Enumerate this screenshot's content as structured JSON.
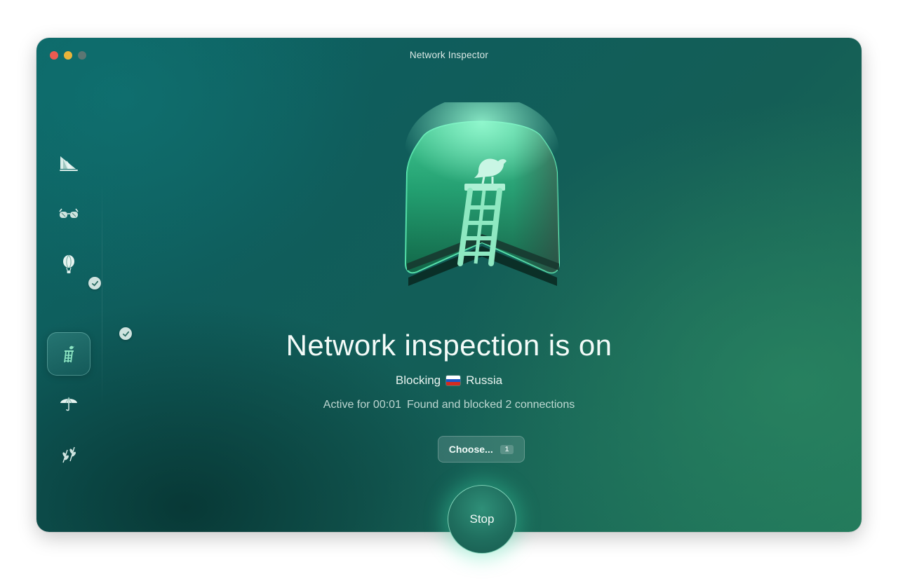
{
  "window": {
    "title": "Network Inspector",
    "traffic_lights": [
      "close",
      "minimize",
      "maximize"
    ]
  },
  "sidebar": {
    "items": [
      {
        "name": "ship-icon",
        "active": false,
        "checked": false
      },
      {
        "name": "glasses-icon",
        "active": false,
        "checked": false
      },
      {
        "name": "balloon-icon",
        "active": false,
        "checked": true
      },
      {
        "name": "lookout-ladder-icon",
        "active": true,
        "checked": true
      },
      {
        "name": "umbrella-icon",
        "active": false,
        "checked": false
      },
      {
        "name": "leaves-icon",
        "active": false,
        "checked": false
      }
    ]
  },
  "main": {
    "hero_icon": "lookout-bird-ladder-icon",
    "headline": "Network inspection is on",
    "status_prefix": "Blocking",
    "country": "Russia",
    "flag_colors": [
      "#ffffff",
      "#1c56c8",
      "#d52b1e"
    ],
    "active_text": "Active for 00:01",
    "found_text": "Found and blocked 2 connections",
    "choose_label": "Choose...",
    "choose_count": "1",
    "stop_label": "Stop"
  },
  "colors": {
    "accent_glow": "#3cdcaa",
    "window_bg": "#0f5d5c"
  }
}
